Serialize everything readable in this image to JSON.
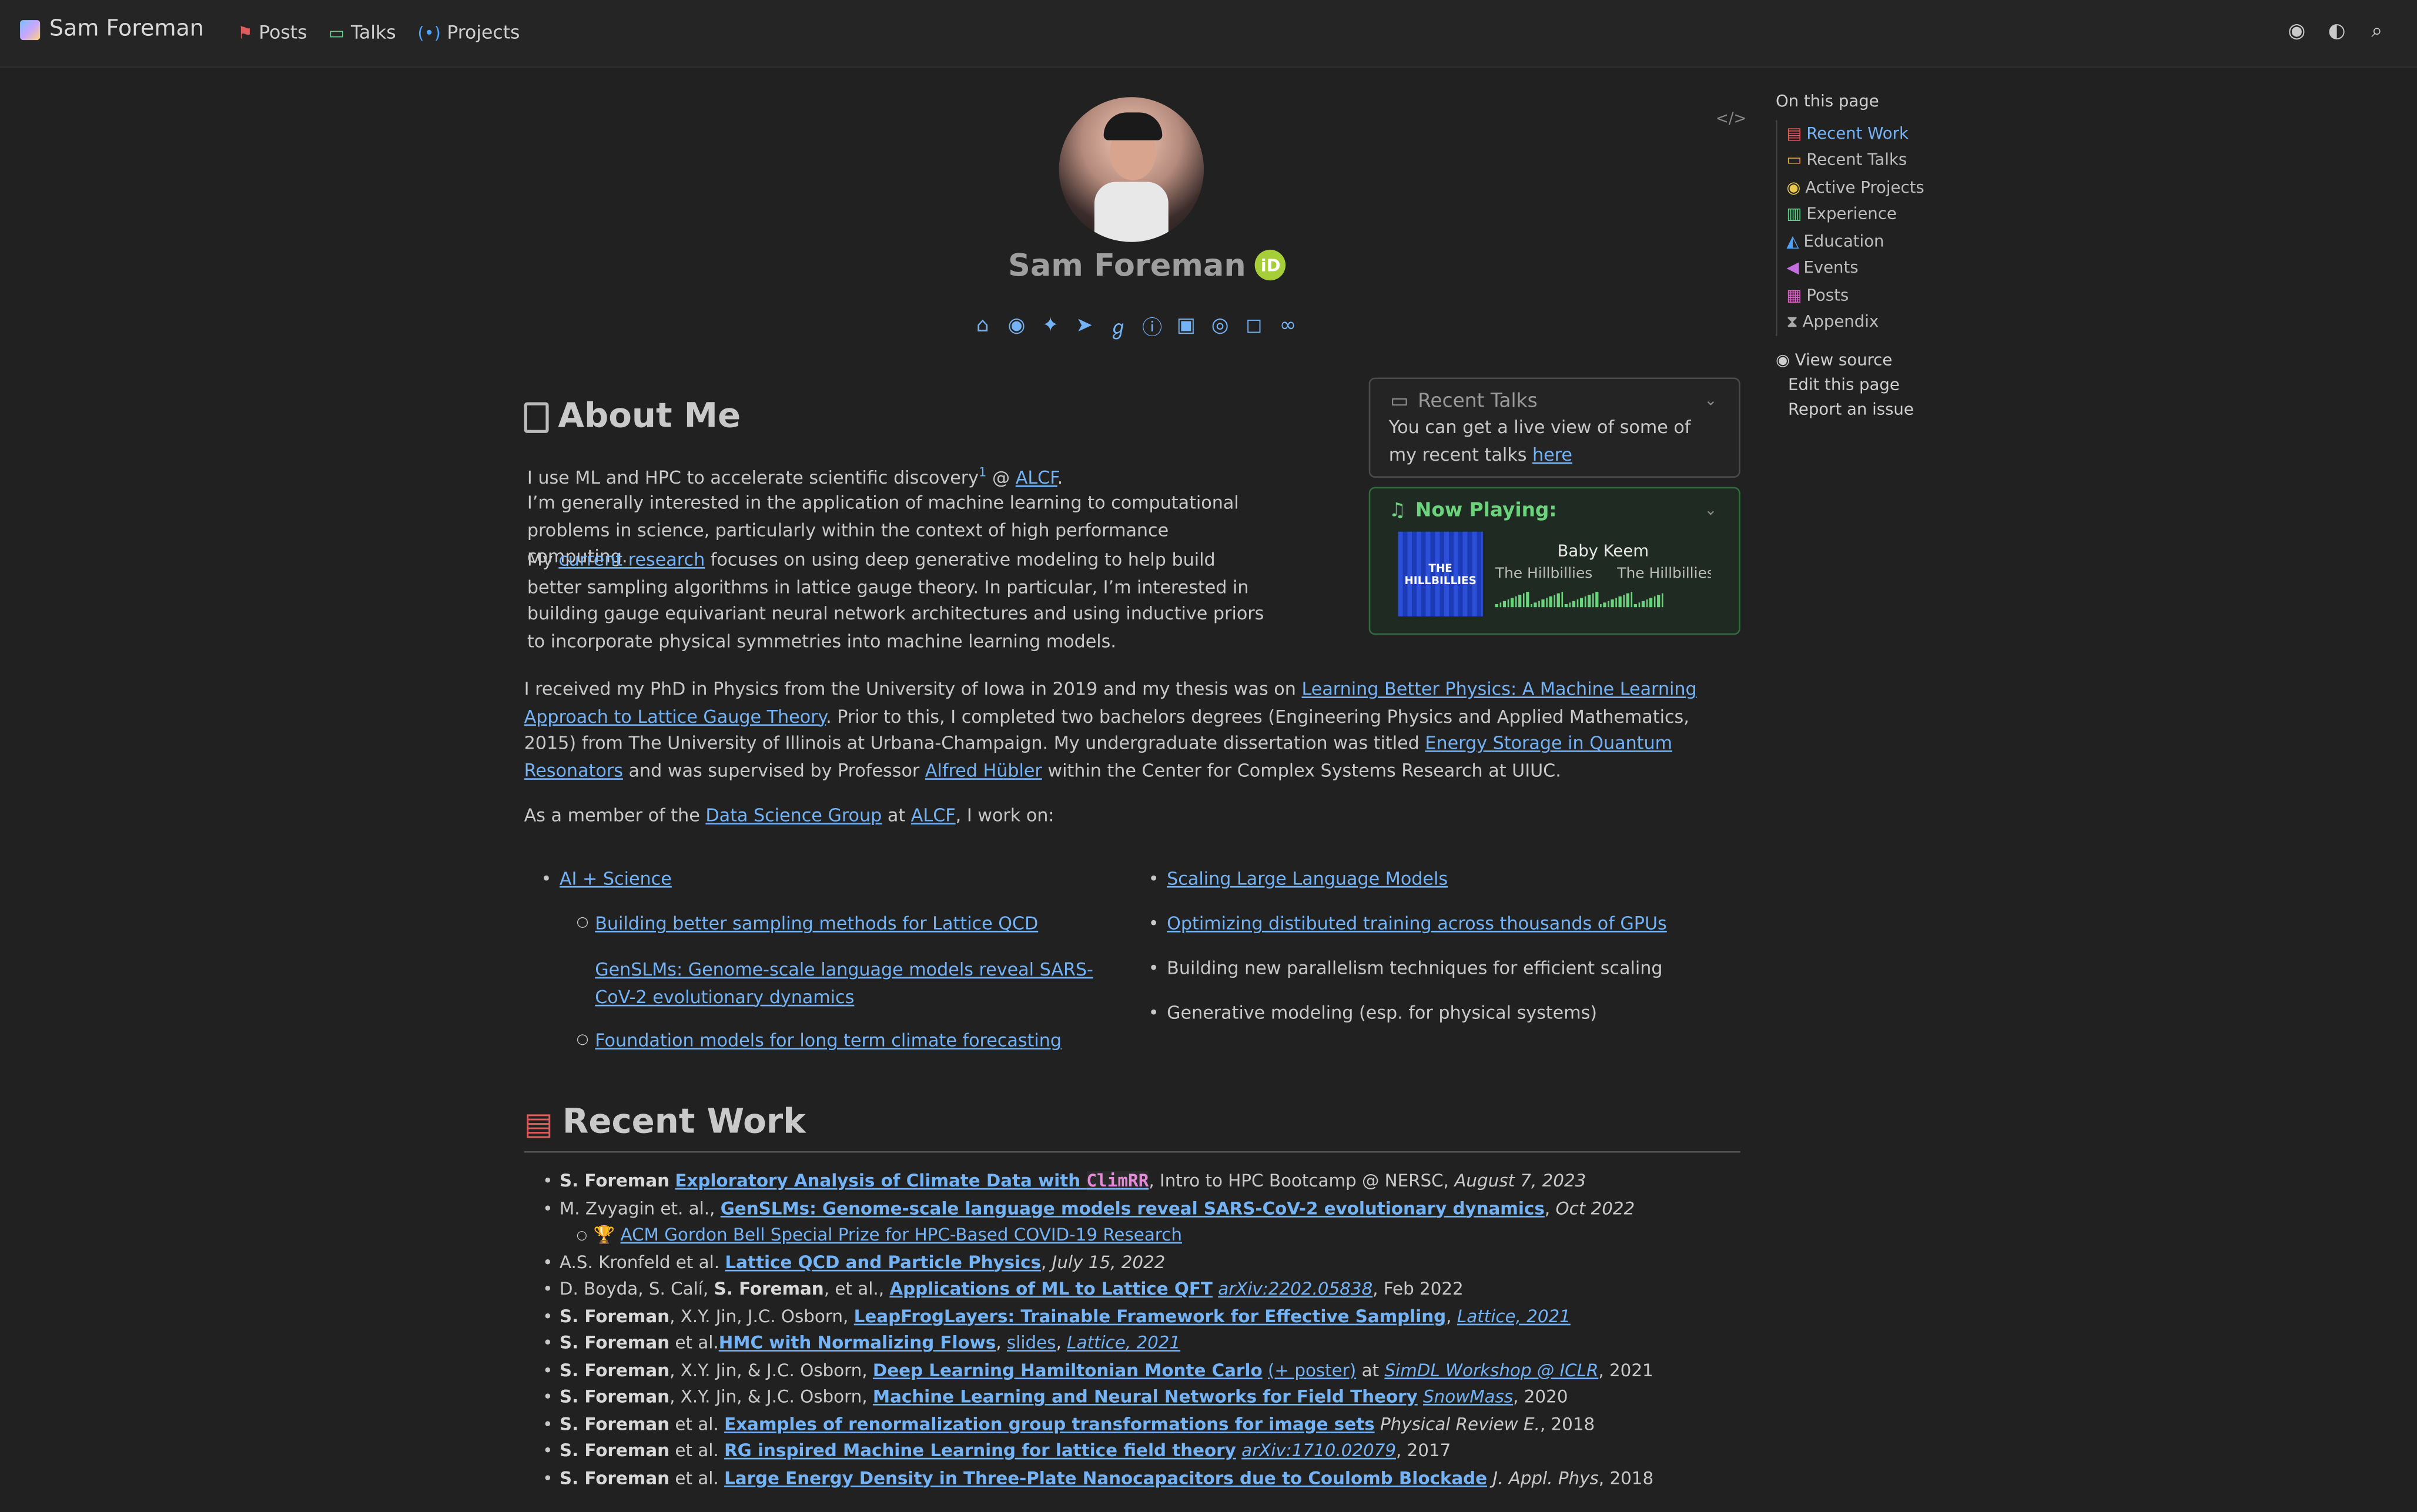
{
  "navbar": {
    "brand": "Sam Foreman",
    "links": [
      {
        "label": "Posts",
        "icon": "signpost-icon",
        "color": "#e05d5d"
      },
      {
        "label": "Talks",
        "icon": "presentation-icon",
        "color": "#5fd38a"
      },
      {
        "label": "Projects",
        "icon": "broadcast-icon",
        "color": "#4aa3ff"
      }
    ]
  },
  "profile": {
    "name": "Sam Foreman",
    "orcid": "iD"
  },
  "toc": {
    "title": "On this page",
    "items": [
      "Recent Work",
      "Recent Talks",
      "Active Projects",
      "Experience",
      "Education",
      "Events",
      "Posts",
      "Appendix"
    ],
    "links": [
      "View source",
      "Edit this page",
      "Report an issue"
    ]
  },
  "about": {
    "heading": "About Me",
    "p1a": "I use ML and HPC to accelerate scientific discovery",
    "p1_sup": "1",
    "p1b": " @ ",
    "p1_link": "ALCF",
    "p1c": ".",
    "p2": "I’m generally interested in the application of machine learning to computational problems in science, particularly within the context of high performance computing.",
    "p3a": "My ",
    "p3_link": "current research",
    "p3b": " focuses on using deep generative modeling to help build better sampling algorithms in lattice gauge theory. In particular, I’m interested in building gauge equivariant neural network architectures and using inductive priors to incorporate physical symmetries into machine learning models.",
    "p4a": "I received my PhD in Physics from the University of Iowa in 2019 and my thesis was on ",
    "p4_link1": "Learning Better Physics: A Machine Learning Approach to Lattice Gauge Theory",
    "p4b": ". Prior to this, I completed two bachelors degrees (Engineering Physics and Applied Mathematics, 2015) from The University of Illinois at Urbana-Champaign. My undergraduate dissertation was titled ",
    "p4_link2": "Energy Storage in Quantum Resonators",
    "p4c": " and was supervised by Professor ",
    "p4_link3": "Alfred Hübler",
    "p4d": " within the Center for Complex Systems Research at UIUC.",
    "p5a": "As a member of the ",
    "p5_link1": "Data Science Group",
    "p5b": " at ",
    "p5_link2": "ALCF",
    "p5c": ", I work on:"
  },
  "recent_talks": {
    "title": "Recent Talks",
    "text": "You can get a live view of some of my recent talks ",
    "link": "here"
  },
  "now_playing": {
    "title": "Now Playing:",
    "album_art_text": "THE HILLBILLIES",
    "artist": "Baby Keem",
    "track": "The Hillbillies",
    "album": "The Hillbillies"
  },
  "work_left": {
    "main": "AI + Science",
    "sub": [
      "Building better sampling methods for Lattice QCD",
      "GenSLMs: Genome-scale language models reveal SARS-CoV-2 evolutionary dynamics",
      "Foundation models for long term climate forecasting"
    ]
  },
  "work_right": [
    "Scaling Large Language Models",
    "Optimizing distibuted training across thousands of GPUs",
    "Building new parallelism techniques for efficient scaling",
    "Generative modeling (esp. for physical systems)"
  ],
  "recent_work": {
    "heading": "Recent Work",
    "items": [
      {
        "a": "S. Foreman",
        "pre": "",
        "link": "Exploratory Analysis of Climate Data with ",
        "code": "ClimRR",
        "post": ", Intro to HPC Bootcamp @ NERSC, ",
        "venue": "August 7, 2023"
      },
      {
        "a": "",
        "pre": "M. Zvyagin et. al., ",
        "link": "GenSLMs: Genome-scale language models reveal SARS-CoV-2 evolutionary dynamics",
        "post": ", ",
        "venue": "Oct 2022"
      },
      {
        "sub": true,
        "link": "ACM Gordon Bell Special Prize for HPC-Based COVID-19 Research",
        "trophy": "🏆"
      },
      {
        "a": "",
        "pre": "A.S. Kronfeld et al. ",
        "link": "Lattice QCD and Particle Physics",
        "post": ", ",
        "venue": "July 15, 2022"
      },
      {
        "a": "S. Foreman",
        "pre": "D. Boyda, S. Calí, ",
        "after_a": ", et al., ",
        "link": "Applications of ML to Lattice QFT",
        "post": " ",
        "venue_link": "arXiv:2202.05838",
        "tail": ", Feb 2022"
      },
      {
        "a": "S. Foreman",
        "after_a": ", X.Y. Jin, J.C. Osborn, ",
        "link": "LeapFrogLayers: Trainable Framework for Effective Sampling",
        "post": ", ",
        "venue_link": "Lattice, 2021"
      },
      {
        "a": "S. Foreman",
        "after_a": " et al.",
        "link": "HMC with Normalizing Flows",
        "post": ", ",
        "extra_link": "slides",
        "post2": ", ",
        "venue_link": "Lattice, 2021"
      },
      {
        "a": "S. Foreman",
        "after_a": ", X.Y. Jin, & J.C. Osborn, ",
        "link": "Deep Learning Hamiltonian Monte Carlo",
        "post": " ",
        "extra_link": "(+ poster)",
        "post2": " at ",
        "venue_link": "SimDL Workshop @ ICLR",
        "tail": ", 2021"
      },
      {
        "a": "S. Foreman",
        "after_a": ", X.Y. Jin, & J.C. Osborn, ",
        "link": "Machine Learning and Neural Networks for Field Theory",
        "post": " ",
        "venue_link": "SnowMass",
        "tail": ", 2020"
      },
      {
        "a": "S. Foreman",
        "after_a": " et al. ",
        "link": "Examples of renormalization group transformations for image sets",
        "post": " ",
        "venue": "Physical Review E.",
        "tail": ", 2018"
      },
      {
        "a": "S. Foreman",
        "after_a": " et al. ",
        "link": "RG inspired Machine Learning for lattice field theory",
        "post": " ",
        "venue_link": "arXiv:1710.02079",
        "tail": ", 2017"
      },
      {
        "a": "S. Foreman",
        "after_a": " et al. ",
        "link": "Large Energy Density in Three-Plate Nanocapacitors due to Coulomb Blockade",
        "post": " ",
        "venue": "J. Appl. Phys",
        "tail": ", 2018"
      }
    ]
  },
  "colors": {
    "link": "#74b3f6",
    "background": "#212121",
    "accent_green": "#6bd37b",
    "heading_red": "#e05d5d"
  }
}
